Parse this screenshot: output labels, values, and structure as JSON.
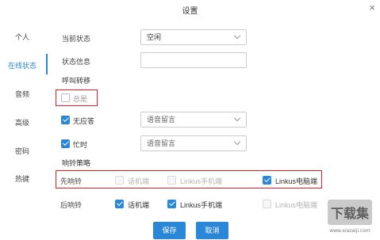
{
  "dialog": {
    "title": "设置",
    "close_symbol": "×"
  },
  "sidebar": {
    "items": [
      {
        "label": "个人",
        "active": false
      },
      {
        "label": "在线状态",
        "active": true
      },
      {
        "label": "音频",
        "active": false
      },
      {
        "label": "高级",
        "active": false
      },
      {
        "label": "密码",
        "active": false
      },
      {
        "label": "热键",
        "active": false
      }
    ]
  },
  "form": {
    "current_status_label": "当前状态",
    "current_status_value": "空闲",
    "status_info_label": "状态信息",
    "status_info_value": "",
    "call_forward_heading": "呼叫转移",
    "always": {
      "label": "总是",
      "checked": false
    },
    "no_answer": {
      "label": "无应答",
      "checked": true,
      "select_value": "语音留言"
    },
    "busy": {
      "label": "忙时",
      "checked": true,
      "select_value": "语音留言"
    },
    "ring_strategy_heading": "响铃策略",
    "first_ring": {
      "label": "先响铃",
      "options": [
        {
          "label": "话机端",
          "checked": false,
          "disabled": true
        },
        {
          "label": "Linkus手机端",
          "checked": false,
          "disabled": true
        },
        {
          "label": "Linkus电脑端",
          "checked": true,
          "disabled": false
        }
      ]
    },
    "after_ring": {
      "label": "后响铃",
      "options": [
        {
          "label": "话机端",
          "checked": true,
          "disabled": false
        },
        {
          "label": "Linkus手机端",
          "checked": true,
          "disabled": false
        },
        {
          "label": "Linkus电脑端",
          "checked": false,
          "disabled": true
        }
      ]
    }
  },
  "buttons": {
    "save": "保存",
    "cancel": "取消"
  },
  "colors": {
    "accent": "#2a86d6",
    "highlight_box": "#e02020"
  },
  "watermark": {
    "text": "下载集",
    "url": "www.xiazaiji.com"
  }
}
